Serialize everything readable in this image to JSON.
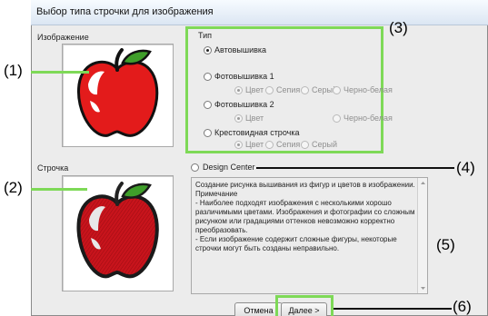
{
  "window": {
    "title": "Выбор типа строчки для изображения"
  },
  "image_panel": {
    "label": "Изображение"
  },
  "stitch_panel": {
    "label": "Строчка"
  },
  "type_group": {
    "label": "Тип",
    "options": {
      "auto": {
        "label": "Автовышивка",
        "selected": true
      },
      "photo1": {
        "label": "Фотовышивка 1",
        "sub": [
          "Цвет",
          "Сепия",
          "Серый",
          "Черно-белая"
        ]
      },
      "photo2": {
        "label": "Фотовышивка 2",
        "sub": [
          "Цвет",
          "Черно-белая"
        ]
      },
      "cross": {
        "label": "Крестовидная строчка",
        "sub": [
          "Цвет",
          "Сепия",
          "Серый"
        ]
      }
    }
  },
  "design_center": {
    "label": "Design Center"
  },
  "description": [
    "Создание рисунка вышивания из фигур и цветов в изображении.",
    "Примечание",
    "- Наиболее подходят изображения с несколькими хорошо различимыми цветами. Изображения и фотографии со сложным рисунком или градациями оттенков невозможно корректно преобразовать.",
    "- Если изображение содержит сложные фигуры, некоторые строчки могут быть созданы неправильно."
  ],
  "buttons": {
    "cancel": "Отмена",
    "next": "Далее >"
  },
  "callouts": [
    "(1)",
    "(2)",
    "(3)",
    "(4)",
    "(5)",
    "(6)"
  ],
  "colors": {
    "highlight": "#7ed957",
    "apple_red": "#e31b1b",
    "leaf_green": "#3f9e2a"
  }
}
